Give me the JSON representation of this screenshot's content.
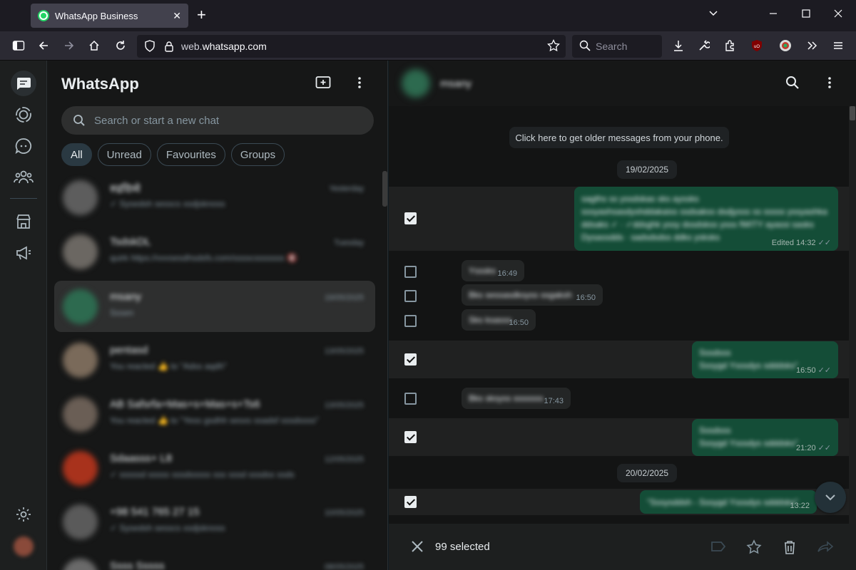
{
  "browser": {
    "tab_title": "WhatsApp Business",
    "tab_close": "✕",
    "new_tab": "+",
    "url_domain": "whatsapp.com",
    "url_prefix": "web.",
    "search_placeholder": "Search",
    "window_controls": [
      "⌄",
      "—",
      "☐",
      "✕"
    ]
  },
  "sidebar": {
    "title": "WhatsApp",
    "search_placeholder": "Search or start a new chat",
    "filters": [
      {
        "label": "All",
        "active": true
      },
      {
        "label": "Unread"
      },
      {
        "label": "Favourites"
      },
      {
        "label": "Groups"
      }
    ],
    "chats": [
      {
        "name": "रुद्रदिव्ये",
        "time": "Yesterday",
        "preview": "✓ Sysedsh sesscs xsdjsknoss",
        "avatar": "#5d5d5d"
      },
      {
        "name": "TsdskDL",
        "time": "Tuesday",
        "preview": "quirk https://vvvsesdhsdsfs.com/sssscsssssss 🔇",
        "avatar": "#6b6762"
      },
      {
        "name": "msany",
        "time": "19/05/2025",
        "preview": "Sssen",
        "avatar": "#2d6a4f",
        "selected": true
      },
      {
        "name": "pentasd",
        "time": "13/05/2025",
        "preview": "You reacted 👍 to \"Adss aqdh\"",
        "avatar": "#7a6a5a"
      },
      {
        "name": "AB Safsrfa+Mas+s+Mas+s+Ts6",
        "time": "13/05/2025",
        "preview": "You reacted 👍 to \"Yess gsdhh sesxs ssadsf sssdssss\"",
        "avatar": "#6a5e55"
      },
      {
        "name": "Sdaasss+ L8",
        "time": "12/05/2025",
        "preview": "✓ sssssd sssss sssdsssss sss sssd sssdss ssds",
        "avatar": "#a8321c"
      },
      {
        "name": "+98 541 765 27 15",
        "time": "10/05/2025",
        "preview": "✓ Sysedsh sesscs xsdjsknoss",
        "avatar": "#5a5a5a"
      },
      {
        "name": "Ssss Sssss",
        "time": "08/05/2025",
        "preview": "",
        "avatar": "#6a6a6a"
      }
    ]
  },
  "conversation": {
    "contact_name": "msany",
    "older_messages": "Click here to get older messages from your phone.",
    "dates": [
      "19/02/2025",
      "20/02/2025"
    ],
    "messages": [
      {
        "dir": "out",
        "checked": true,
        "lines": [
          "sagths ss yssdskas sks ayssks",
          "sssyashsasdyshddakaiss ssdsakss dsdjysss ss sssss yssyashka",
          "ddsaks ✓ · ✓ddsghk yssy dssdskss ysss fWITY ayassi sasks",
          "Dysassdds · sadsdsdss ddks ysksks"
        ],
        "meta": "Edited 14:32"
      },
      {
        "dir": "in",
        "checked": false,
        "lines": [
          "Ysssks"
        ],
        "meta": "16:49"
      },
      {
        "dir": "in",
        "checked": false,
        "lines": [
          "Bks sessasdksyss ssgaksh"
        ],
        "meta": "16:50"
      },
      {
        "dir": "in",
        "checked": false,
        "lines": [
          "Sks ksasss"
        ],
        "meta": "16:50"
      },
      {
        "dir": "out",
        "checked": true,
        "lines": [
          "Sssdsss",
          "Sssygd Ysssdys sdddsks\""
        ],
        "meta": "16:50"
      },
      {
        "dir": "in",
        "checked": false,
        "lines": [
          "Bks sksyss sssssss"
        ],
        "meta": "17:43"
      },
      {
        "dir": "out",
        "checked": true,
        "lines": [
          "Sssdsss",
          "Sssygd Ysssdys sdddsks\""
        ],
        "meta": "21:20"
      },
      {
        "dir": "out",
        "checked": true,
        "lines": [
          "\"Sssysddsh - Sssygd Ysssdys sdddsks\""
        ],
        "meta": "13:22"
      }
    ],
    "selection": {
      "count_label": "99 selected"
    }
  },
  "colors": {
    "accent": "#25d366",
    "outgoing_bubble": "#144d37",
    "incoming_bubble": "#242626",
    "panel": "#161717"
  },
  "icons": [
    "whatsapp-icon",
    "sidebar-toggle-icon",
    "back-icon",
    "forward-icon",
    "home-icon",
    "reload-icon",
    "shield-icon",
    "lock-icon",
    "bookmark-star-icon",
    "search-icon",
    "download-icon",
    "wrench-icon",
    "extensions-icon",
    "ublock-icon",
    "profile-extension-icon",
    "overflow-icon",
    "hamburger-icon",
    "chats-icon",
    "status-icon",
    "channels-icon",
    "communities-icon",
    "catalog-icon",
    "broadcast-icon",
    "settings-icon",
    "new-chat-icon",
    "kebab-menu-icon",
    "close-icon",
    "label-icon",
    "star-icon",
    "delete-icon",
    "forward-message-icon",
    "scroll-down-icon"
  ]
}
